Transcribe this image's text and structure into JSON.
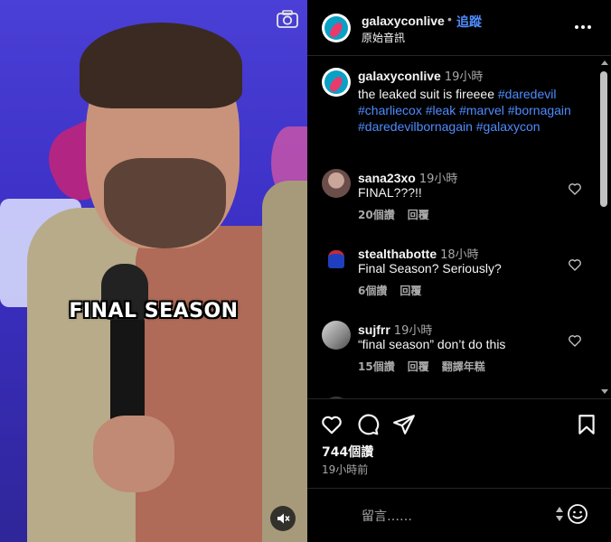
{
  "video": {
    "caption": "FINAL SEASON",
    "icons": {
      "camera": "camera-icon",
      "mute": "muted-speaker-icon"
    }
  },
  "header": {
    "username": "galaxyconlive",
    "separator": "•",
    "follow_label": "追蹤",
    "audio_label": "原始音訊",
    "more_icon": "more-horizontal-icon"
  },
  "caption_post": {
    "username": "galaxyconlive",
    "time": "19小時",
    "text": "the leaked suit is fireeee",
    "hashtags": [
      "#daredevil",
      "#charliecox",
      "#leak",
      "#marvel",
      "#bornagain",
      "#daredevilbornagain",
      "#galaxycon"
    ]
  },
  "comments": [
    {
      "username": "sana23xo",
      "time": "19小時",
      "text": "FINAL???!!",
      "likes": "20個讚",
      "reply": "回覆",
      "translate": ""
    },
    {
      "username": "stealthabotte",
      "time": "18小時",
      "text": "Final Season? Seriously?",
      "likes": "6個讚",
      "reply": "回覆",
      "translate": ""
    },
    {
      "username": "sujfrr",
      "time": "19小時",
      "text": "“final season” don’t do this",
      "likes": "15個讚",
      "reply": "回覆",
      "translate": "翻譯年糕"
    }
  ],
  "actions": {
    "like_icon": "heart-icon",
    "comment_icon": "comment-bubble-icon",
    "share_icon": "paper-plane-icon",
    "save_icon": "bookmark-icon",
    "likes_count": "744個讚",
    "posted_time": "19小時前"
  },
  "comment_box": {
    "placeholder": "留言……",
    "emoji_icon": "smiley-icon"
  },
  "colors": {
    "link": "#4f8cff",
    "muted": "#a8a8a8",
    "background": "#000000",
    "video_bg": "#3b2fc4"
  }
}
